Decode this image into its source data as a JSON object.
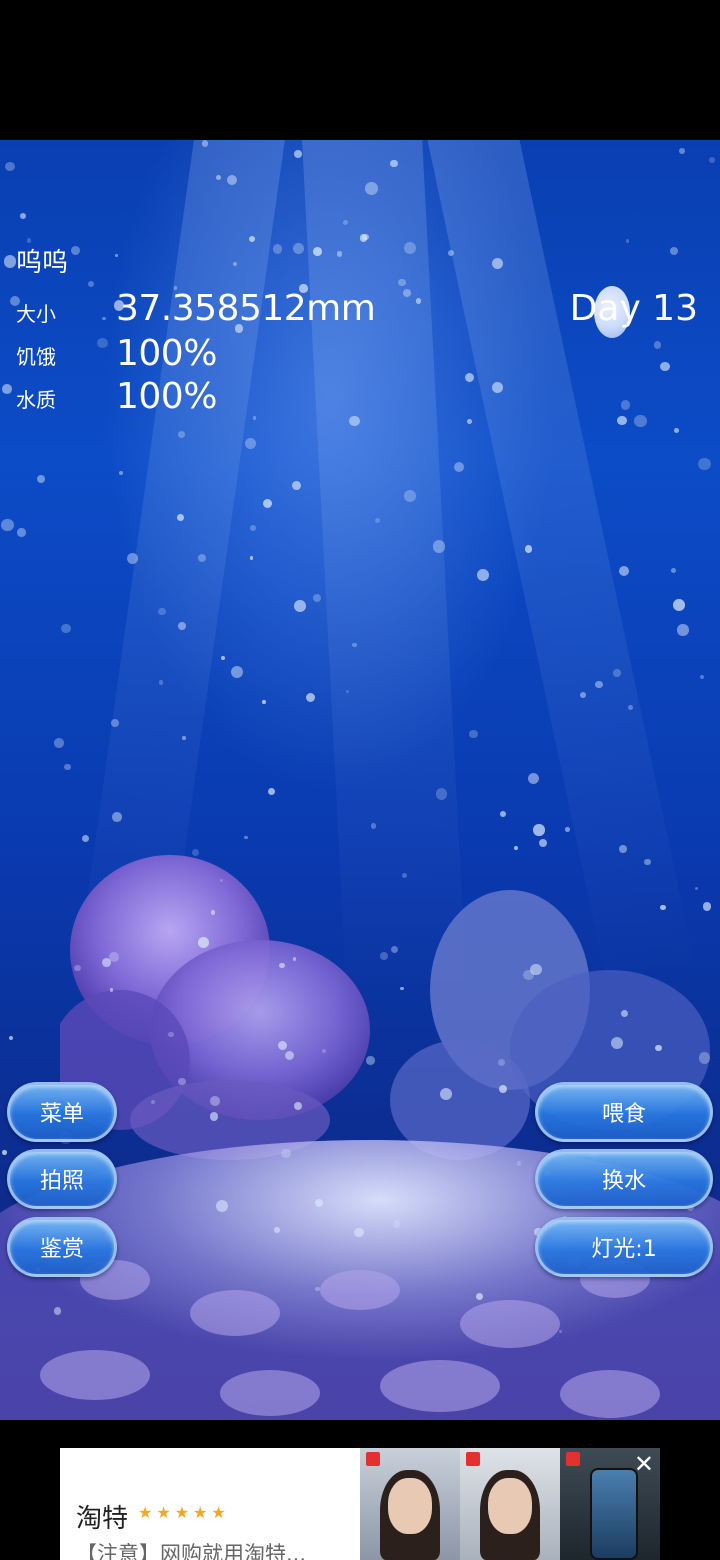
{
  "pet": {
    "name": "呜呜",
    "size_label": "大小",
    "size_value": "37.358512mm",
    "hunger_label": "饥饿",
    "hunger_value": "100%",
    "water_label": "水质",
    "water_value": "100%",
    "day": "Day 13"
  },
  "buttons": {
    "menu": "菜单",
    "photo": "拍照",
    "appreciate": "鉴赏",
    "feed": "喂食",
    "change_water": "换水",
    "light": "灯光:1"
  },
  "ad": {
    "brand": "淘特",
    "stars": "★★★★★",
    "text": "【注意】网购就用淘特...",
    "close": "✕"
  },
  "colors": {
    "water_top": "#0a3fb2",
    "water_bottom": "#14237a",
    "button": "#2878e1",
    "star": "#f5a623"
  }
}
